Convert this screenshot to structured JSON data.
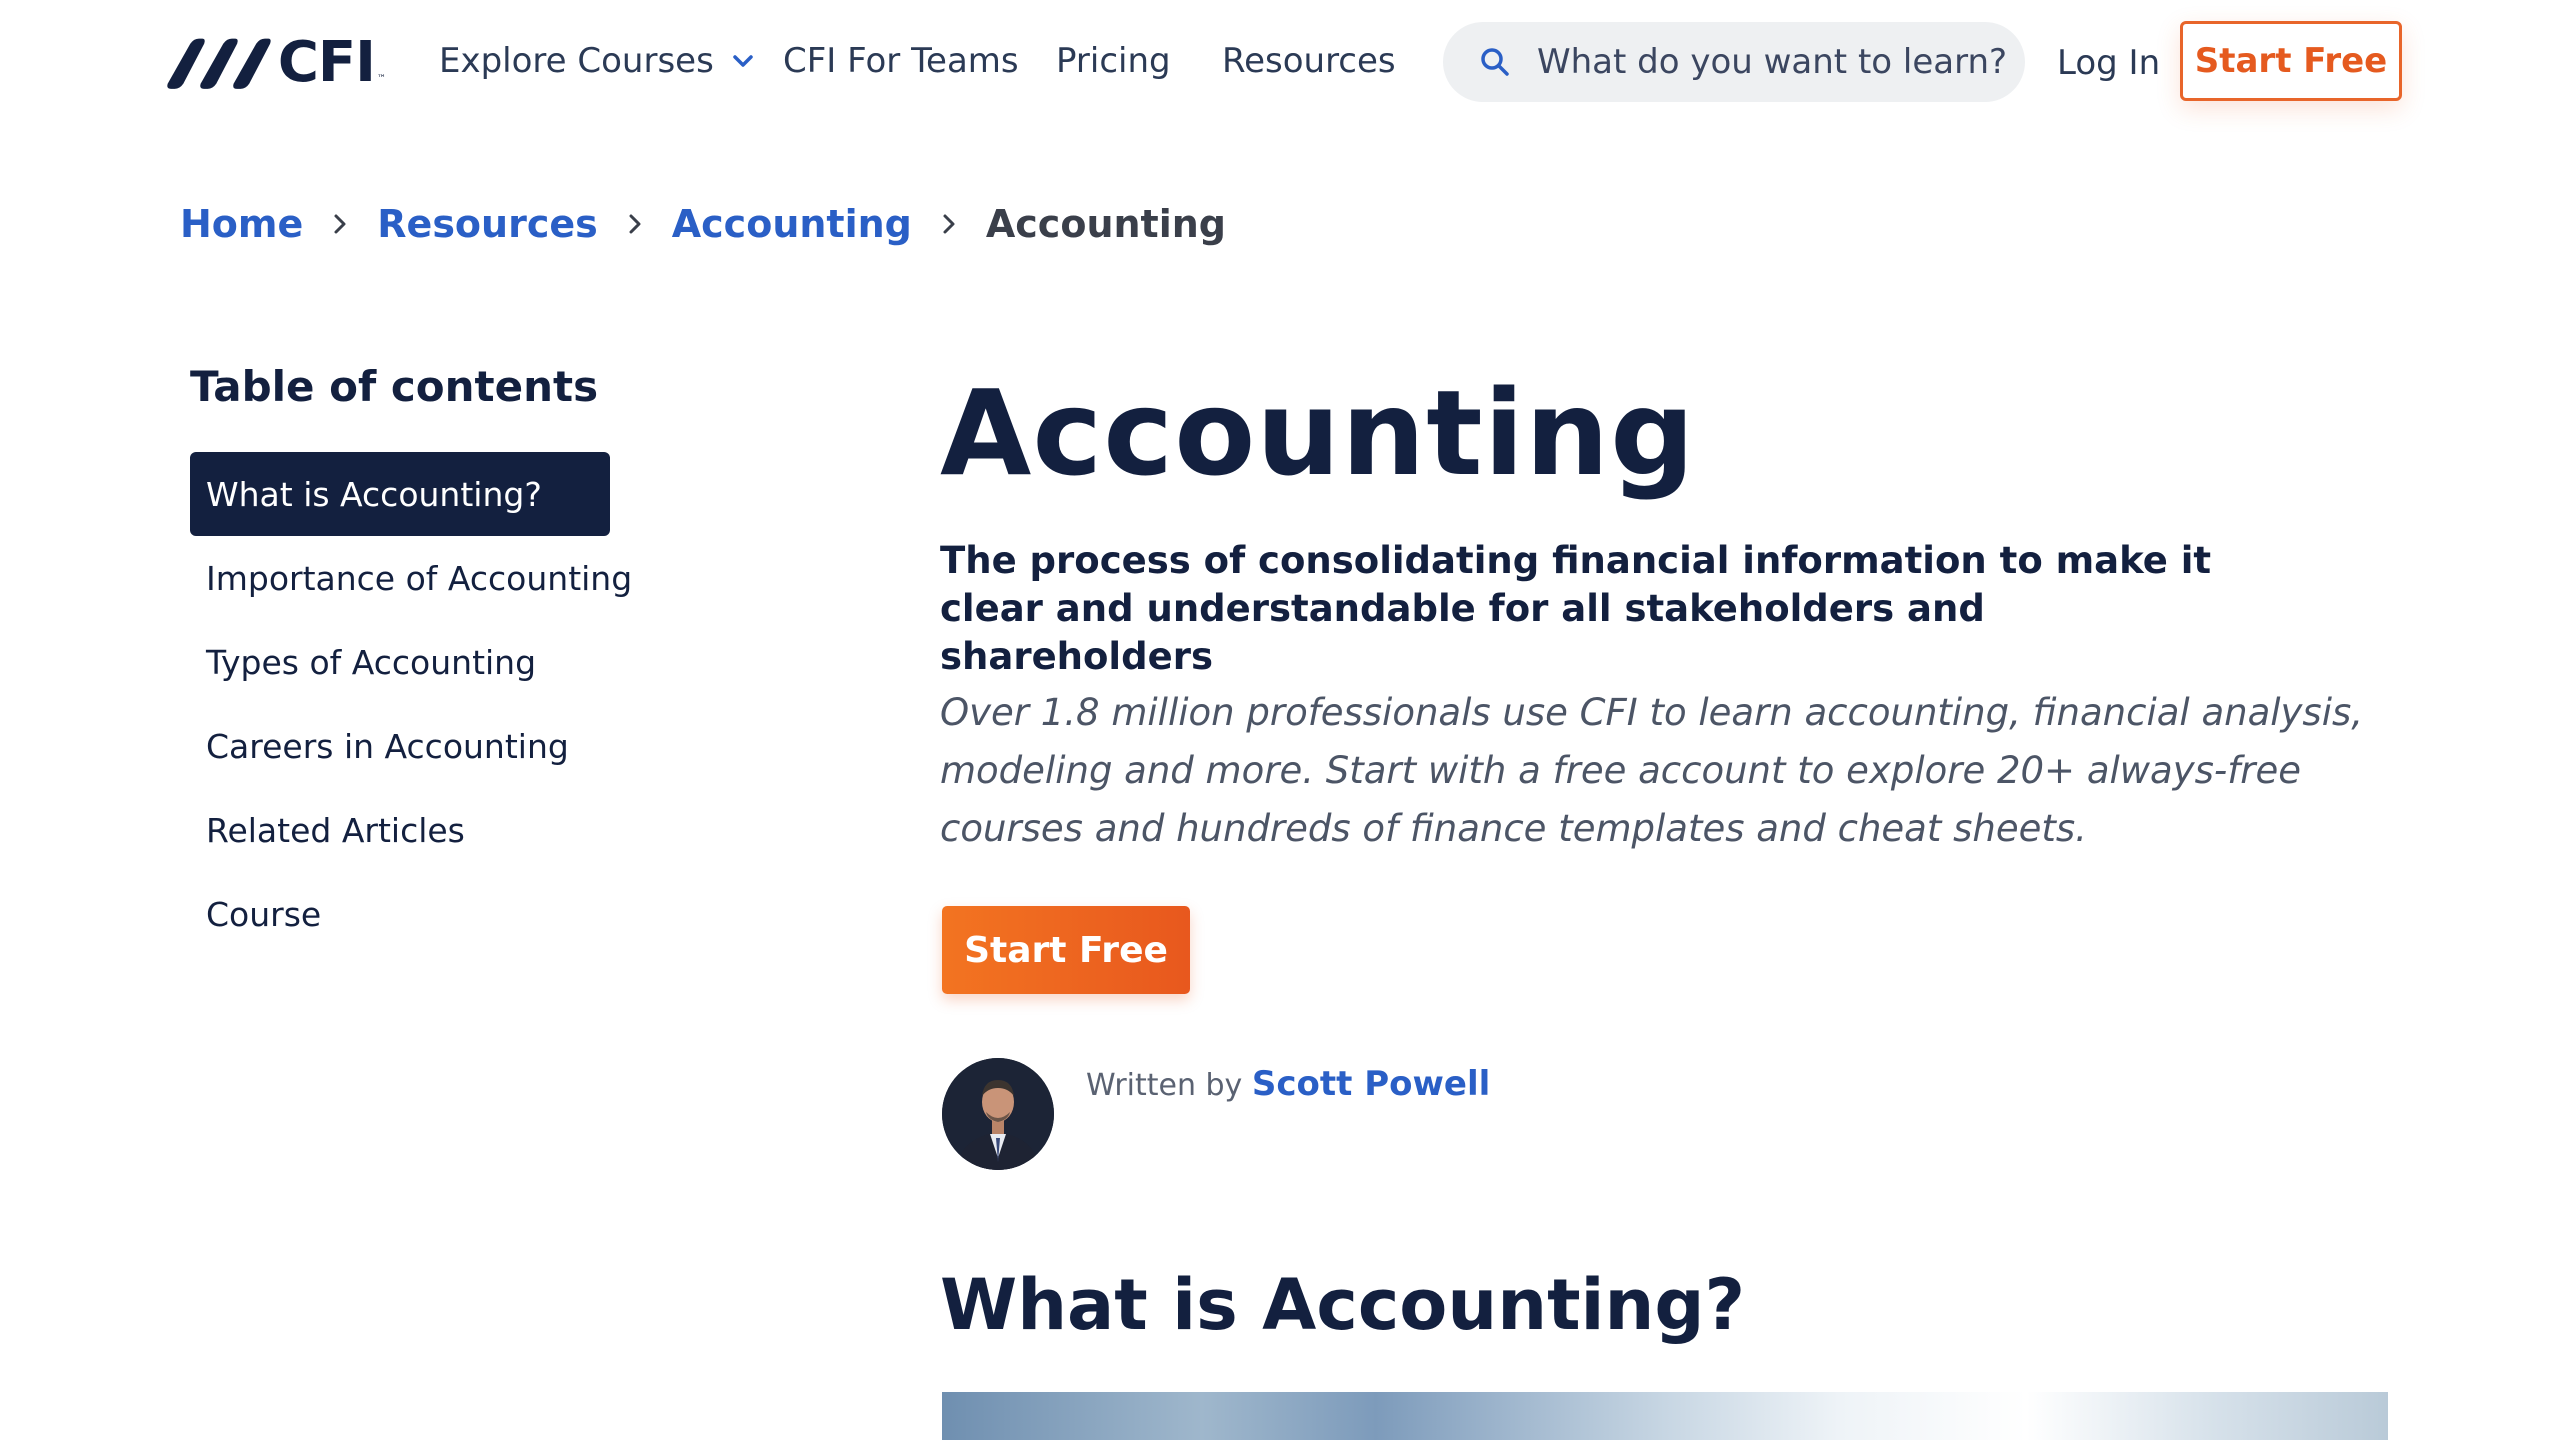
{
  "header": {
    "logo_text": "CFI",
    "nav": {
      "explore": "Explore Courses",
      "teams": "CFI For Teams",
      "pricing": "Pricing",
      "resources": "Resources"
    },
    "search": {
      "placeholder": "What do you want to learn?"
    },
    "login": "Log In",
    "start_free": "Start Free"
  },
  "breadcrumb": {
    "items": [
      "Home",
      "Resources",
      "Accounting"
    ],
    "current": "Accounting"
  },
  "toc": {
    "title": "Table of contents",
    "items": [
      "What is Accounting?",
      "Importance of Accounting",
      "Types of Accounting",
      "Careers in Accounting",
      "Related Articles",
      "Course"
    ]
  },
  "article": {
    "title": "Accounting",
    "subtitle": "The process of consolidating financial information to make it clear and understandable for all stakeholders and shareholders",
    "promo": "Over 1.8 million professionals use CFI to learn accounting, financial analysis, modeling and more. Start with a free account to explore 20+ always-free courses and hundreds of finance templates and cheat sheets.",
    "cta": "Start Free",
    "written_by": "Written by",
    "author": "Scott Powell",
    "section_heading": "What is Accounting?"
  },
  "colors": {
    "navy": "#13203f",
    "link_blue": "#2a5fc6",
    "orange": "#e8652a"
  },
  "icons": [
    "logo-mark-icon",
    "chevron-down-icon",
    "search-icon",
    "chevron-right-icon"
  ]
}
